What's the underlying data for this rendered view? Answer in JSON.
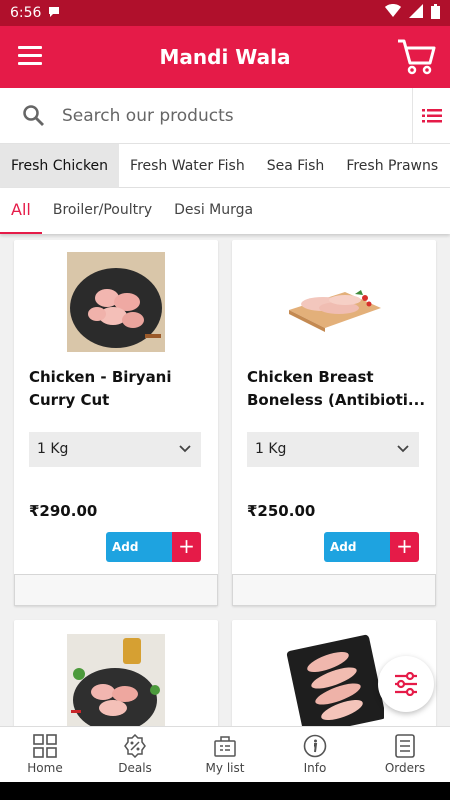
{
  "status": {
    "time": "6:56",
    "icons": [
      "chat-icon",
      "wifi-icon",
      "signal-icon",
      "battery-icon"
    ]
  },
  "app": {
    "title": "Mandi Wala"
  },
  "search": {
    "placeholder": "Search our products"
  },
  "categories": [
    {
      "label": "Fresh Chicken",
      "active": true
    },
    {
      "label": "Fresh Water Fish",
      "active": false
    },
    {
      "label": "Sea Fish",
      "active": false
    },
    {
      "label": "Fresh Prawns",
      "active": false
    }
  ],
  "subcategories": [
    {
      "label": "All",
      "active": true
    },
    {
      "label": "Broiler/Poultry",
      "active": false
    },
    {
      "label": "Desi Murga",
      "active": false
    }
  ],
  "products": [
    {
      "name": "Chicken - Biryani Curry Cut (Antibioti...",
      "qty": "1 Kg",
      "price": "₹290.00",
      "add_label": "Add"
    },
    {
      "name": "Chicken Breast Boneless  (Antibioti...",
      "qty": "1 Kg",
      "price": "₹250.00",
      "add_label": "Add"
    }
  ],
  "nav": [
    {
      "label": "Home",
      "icon": "grid-icon"
    },
    {
      "label": "Deals",
      "icon": "discount-icon"
    },
    {
      "label": "My list",
      "icon": "basket-icon"
    },
    {
      "label": "Info",
      "icon": "info-icon"
    },
    {
      "label": "Orders",
      "icon": "orders-icon"
    }
  ],
  "colors": {
    "primary": "#e51b48",
    "add_button": "#1ea3e0",
    "status_bar": "#b0102c"
  }
}
